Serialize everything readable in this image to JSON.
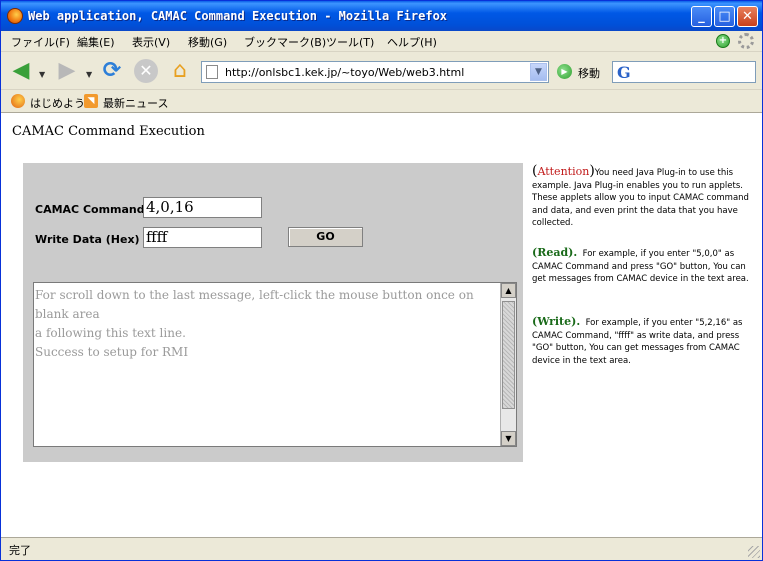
{
  "window": {
    "title": "Web application, CAMAC Command Execution - Mozilla Firefox"
  },
  "menu": [
    "ファイル(F)",
    "編集(E)",
    "表示(V)",
    "移動(G)",
    "ブックマーク(B)",
    "ツール(T)",
    "ヘルプ(H)"
  ],
  "navigation": {
    "url": "http://onlsbc1.kek.jp/~toyo/Web/web3.html",
    "go_label": "移動",
    "search_engine_glyph": "G"
  },
  "bookmarks": [
    "はじめよう",
    "最新ニュース"
  ],
  "page": {
    "title": "CAMAC Command Execution",
    "form": {
      "command_label": "CAMAC Command:",
      "command_value": "4,0,16",
      "write_label": "Write Data (Hex) :",
      "write_value": "ffff",
      "go_button": "GO"
    },
    "output": {
      "line1": "For scroll down to the last message, left-click the mouse button once on blank area",
      "line2": "a following this text line.",
      "line3": "Success to setup for RMI"
    },
    "sidebar": {
      "attention_head": "Attention",
      "attention_text": "You need Java Plug-in to use this example. Java Plug-in enables you to run applets. These applets allow you to input CAMAC command and data, and even print the data that you have collected.",
      "read_head": "(Read).",
      "read_text": "For example, if you enter \"5,0,0\" as CAMAC Command and press \"GO\" button, You can get messages from CAMAC device in the text area.",
      "write_head": "(Write).",
      "write_text": "For example, if you enter \"5,2,16\" as CAMAC Command, \"ffff\" as write data, and press \"GO\" button, You can get messages from CAMAC device in the text area."
    }
  },
  "status": "完了"
}
